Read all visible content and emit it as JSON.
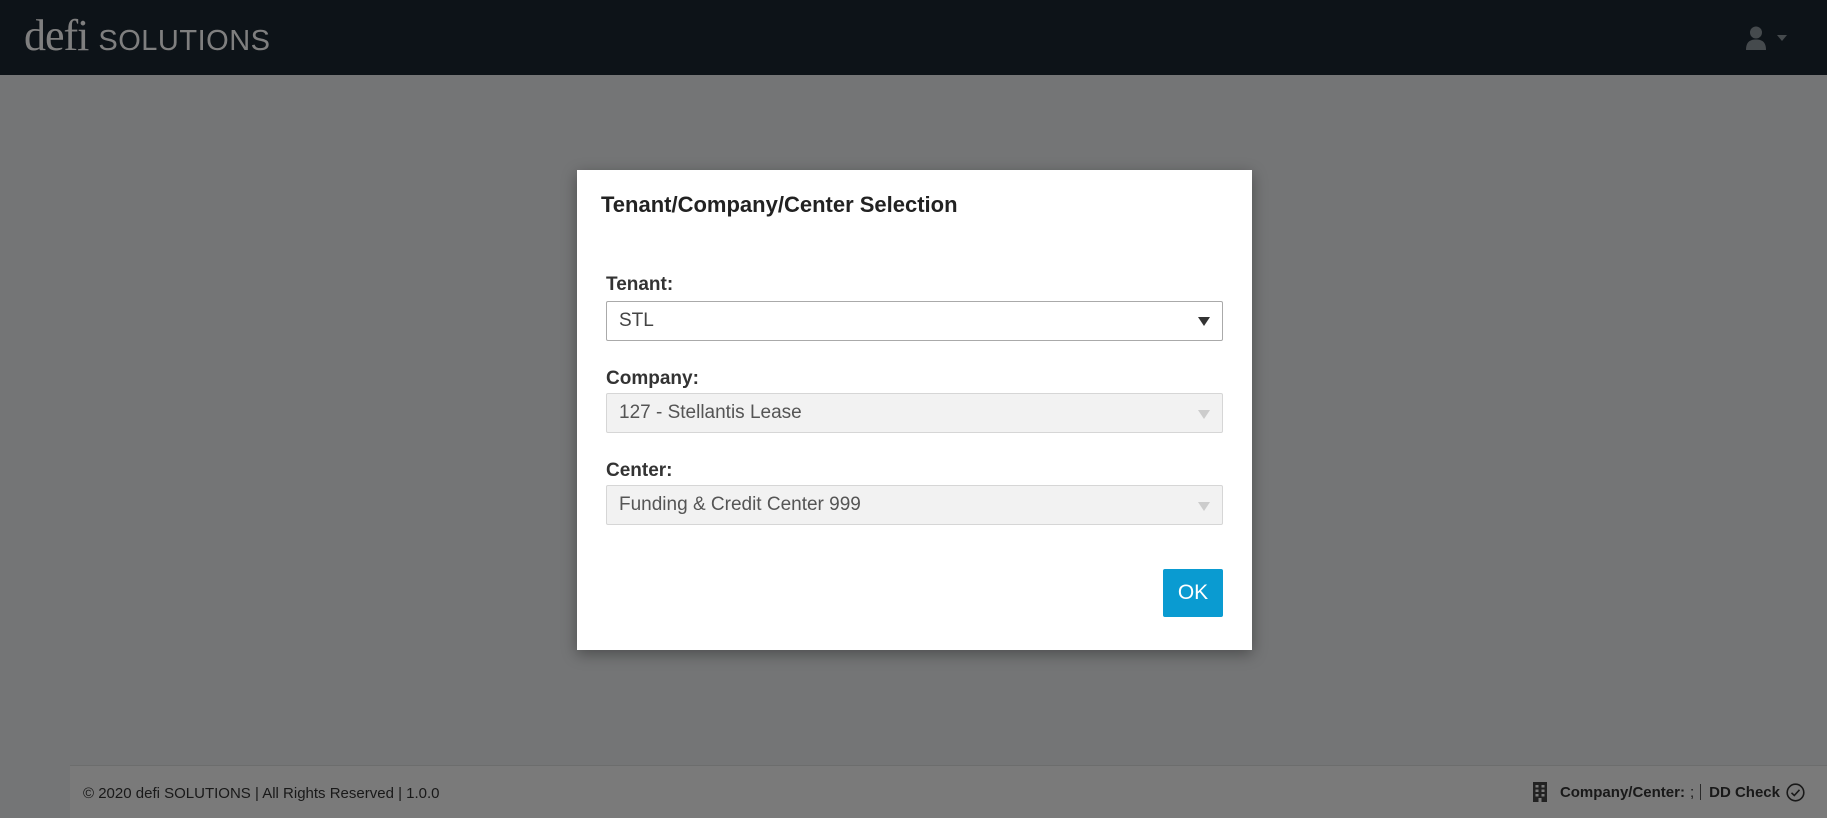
{
  "header": {
    "logo_defi": "defi",
    "logo_solutions": "SOLUTIONS",
    "user_icon": "user-icon",
    "menu_caret_icon": "caret-down-icon",
    "background_color": "#1b2630"
  },
  "modal": {
    "title": "Tenant/Company/Center Selection",
    "tenant": {
      "label": "Tenant:",
      "value": "STL"
    },
    "company": {
      "label": "Company:",
      "value": "127 - Stellantis Lease",
      "disabled": true
    },
    "center": {
      "label": "Center:",
      "value": "Funding & Credit Center 999",
      "disabled": true
    },
    "ok_label": "OK",
    "ok_color": "#0a9bd1"
  },
  "footer": {
    "copyright": "© 2020 defi SOLUTIONS | All Rights Reserved | 1.0.0",
    "building_icon": "building-icon",
    "company_center_label": "Company/Center:",
    "company_center_value": ";",
    "dd_check_label": "DD Check",
    "check_icon": "check-circle-icon"
  }
}
